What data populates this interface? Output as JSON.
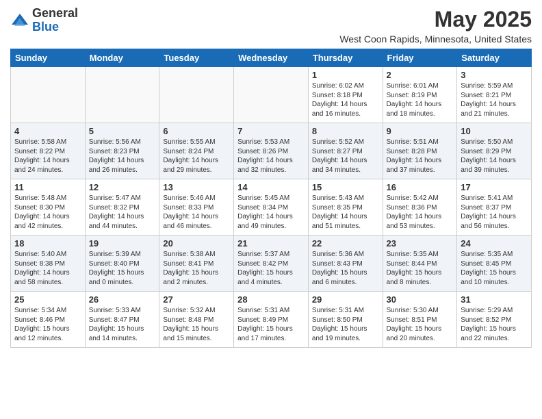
{
  "header": {
    "logo_general": "General",
    "logo_blue": "Blue",
    "month_year": "May 2025",
    "location": "West Coon Rapids, Minnesota, United States"
  },
  "days_of_week": [
    "Sunday",
    "Monday",
    "Tuesday",
    "Wednesday",
    "Thursday",
    "Friday",
    "Saturday"
  ],
  "weeks": [
    [
      {
        "day": "",
        "info": ""
      },
      {
        "day": "",
        "info": ""
      },
      {
        "day": "",
        "info": ""
      },
      {
        "day": "",
        "info": ""
      },
      {
        "day": "1",
        "info": "Sunrise: 6:02 AM\nSunset: 8:18 PM\nDaylight: 14 hours\nand 16 minutes."
      },
      {
        "day": "2",
        "info": "Sunrise: 6:01 AM\nSunset: 8:19 PM\nDaylight: 14 hours\nand 18 minutes."
      },
      {
        "day": "3",
        "info": "Sunrise: 5:59 AM\nSunset: 8:21 PM\nDaylight: 14 hours\nand 21 minutes."
      }
    ],
    [
      {
        "day": "4",
        "info": "Sunrise: 5:58 AM\nSunset: 8:22 PM\nDaylight: 14 hours\nand 24 minutes."
      },
      {
        "day": "5",
        "info": "Sunrise: 5:56 AM\nSunset: 8:23 PM\nDaylight: 14 hours\nand 26 minutes."
      },
      {
        "day": "6",
        "info": "Sunrise: 5:55 AM\nSunset: 8:24 PM\nDaylight: 14 hours\nand 29 minutes."
      },
      {
        "day": "7",
        "info": "Sunrise: 5:53 AM\nSunset: 8:26 PM\nDaylight: 14 hours\nand 32 minutes."
      },
      {
        "day": "8",
        "info": "Sunrise: 5:52 AM\nSunset: 8:27 PM\nDaylight: 14 hours\nand 34 minutes."
      },
      {
        "day": "9",
        "info": "Sunrise: 5:51 AM\nSunset: 8:28 PM\nDaylight: 14 hours\nand 37 minutes."
      },
      {
        "day": "10",
        "info": "Sunrise: 5:50 AM\nSunset: 8:29 PM\nDaylight: 14 hours\nand 39 minutes."
      }
    ],
    [
      {
        "day": "11",
        "info": "Sunrise: 5:48 AM\nSunset: 8:30 PM\nDaylight: 14 hours\nand 42 minutes."
      },
      {
        "day": "12",
        "info": "Sunrise: 5:47 AM\nSunset: 8:32 PM\nDaylight: 14 hours\nand 44 minutes."
      },
      {
        "day": "13",
        "info": "Sunrise: 5:46 AM\nSunset: 8:33 PM\nDaylight: 14 hours\nand 46 minutes."
      },
      {
        "day": "14",
        "info": "Sunrise: 5:45 AM\nSunset: 8:34 PM\nDaylight: 14 hours\nand 49 minutes."
      },
      {
        "day": "15",
        "info": "Sunrise: 5:43 AM\nSunset: 8:35 PM\nDaylight: 14 hours\nand 51 minutes."
      },
      {
        "day": "16",
        "info": "Sunrise: 5:42 AM\nSunset: 8:36 PM\nDaylight: 14 hours\nand 53 minutes."
      },
      {
        "day": "17",
        "info": "Sunrise: 5:41 AM\nSunset: 8:37 PM\nDaylight: 14 hours\nand 56 minutes."
      }
    ],
    [
      {
        "day": "18",
        "info": "Sunrise: 5:40 AM\nSunset: 8:38 PM\nDaylight: 14 hours\nand 58 minutes."
      },
      {
        "day": "19",
        "info": "Sunrise: 5:39 AM\nSunset: 8:40 PM\nDaylight: 15 hours\nand 0 minutes."
      },
      {
        "day": "20",
        "info": "Sunrise: 5:38 AM\nSunset: 8:41 PM\nDaylight: 15 hours\nand 2 minutes."
      },
      {
        "day": "21",
        "info": "Sunrise: 5:37 AM\nSunset: 8:42 PM\nDaylight: 15 hours\nand 4 minutes."
      },
      {
        "day": "22",
        "info": "Sunrise: 5:36 AM\nSunset: 8:43 PM\nDaylight: 15 hours\nand 6 minutes."
      },
      {
        "day": "23",
        "info": "Sunrise: 5:35 AM\nSunset: 8:44 PM\nDaylight: 15 hours\nand 8 minutes."
      },
      {
        "day": "24",
        "info": "Sunrise: 5:35 AM\nSunset: 8:45 PM\nDaylight: 15 hours\nand 10 minutes."
      }
    ],
    [
      {
        "day": "25",
        "info": "Sunrise: 5:34 AM\nSunset: 8:46 PM\nDaylight: 15 hours\nand 12 minutes."
      },
      {
        "day": "26",
        "info": "Sunrise: 5:33 AM\nSunset: 8:47 PM\nDaylight: 15 hours\nand 14 minutes."
      },
      {
        "day": "27",
        "info": "Sunrise: 5:32 AM\nSunset: 8:48 PM\nDaylight: 15 hours\nand 15 minutes."
      },
      {
        "day": "28",
        "info": "Sunrise: 5:31 AM\nSunset: 8:49 PM\nDaylight: 15 hours\nand 17 minutes."
      },
      {
        "day": "29",
        "info": "Sunrise: 5:31 AM\nSunset: 8:50 PM\nDaylight: 15 hours\nand 19 minutes."
      },
      {
        "day": "30",
        "info": "Sunrise: 5:30 AM\nSunset: 8:51 PM\nDaylight: 15 hours\nand 20 minutes."
      },
      {
        "day": "31",
        "info": "Sunrise: 5:29 AM\nSunset: 8:52 PM\nDaylight: 15 hours\nand 22 minutes."
      }
    ]
  ]
}
